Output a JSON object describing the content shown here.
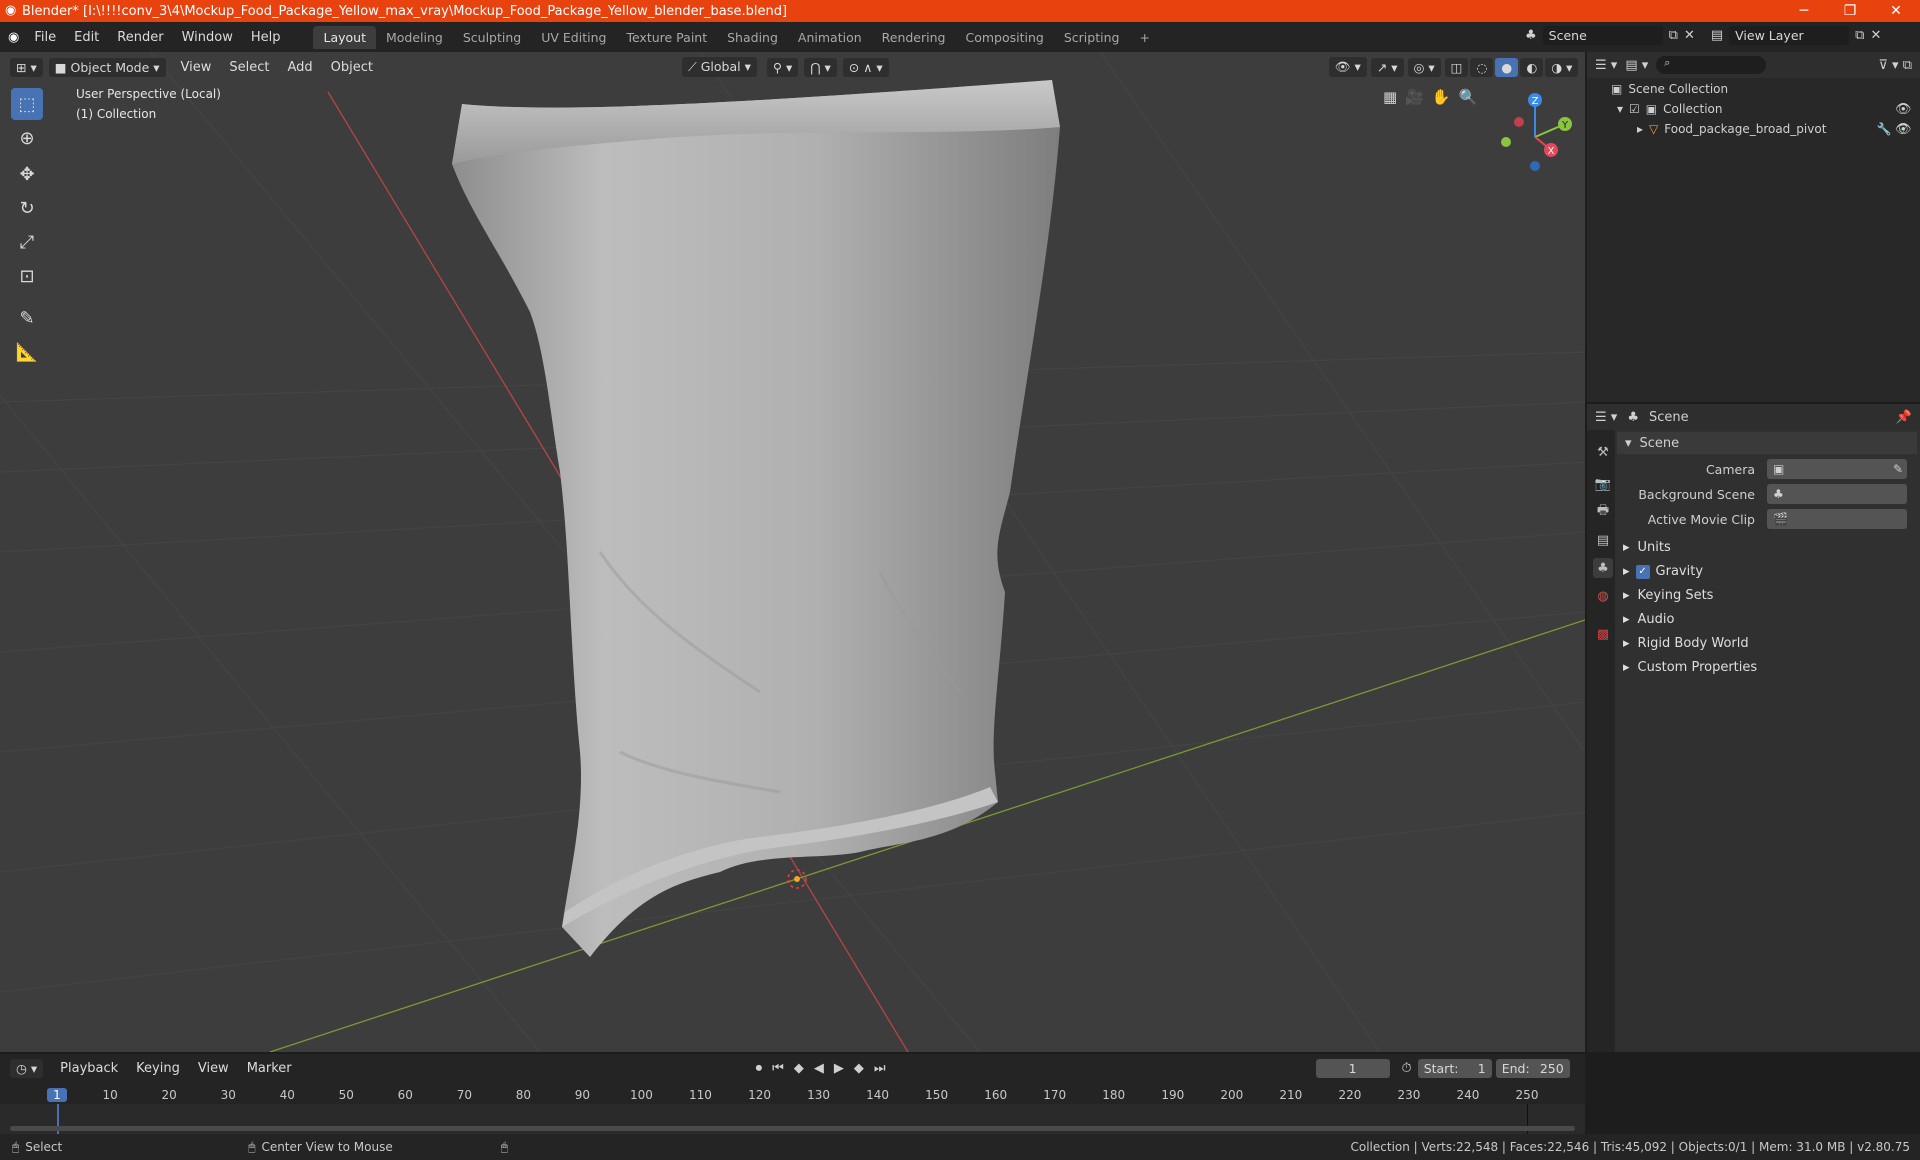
{
  "window": {
    "title": "Blender* [I:\\!!!!conv_3\\4\\Mockup_Food_Package_Yellow_max_vray\\Mockup_Food_Package_Yellow_blender_base.blend]"
  },
  "menus": [
    "File",
    "Edit",
    "Render",
    "Window",
    "Help"
  ],
  "workspaces": [
    "Layout",
    "Modeling",
    "Sculpting",
    "UV Editing",
    "Texture Paint",
    "Shading",
    "Animation",
    "Rendering",
    "Compositing",
    "Scripting"
  ],
  "active_workspace": "Layout",
  "top_right": {
    "scene": "Scene",
    "view_layer": "View Layer"
  },
  "viewport": {
    "mode": "Object Mode",
    "header_menus": [
      "View",
      "Select",
      "Add",
      "Object"
    ],
    "orientation": "Global",
    "overlay_text_1": "User Perspective (Local)",
    "overlay_text_2": "(1) Collection",
    "gizmo_axes": {
      "z": "Z",
      "y": "Y",
      "x": "X"
    }
  },
  "outliner": {
    "root": "Scene Collection",
    "collection": "Collection",
    "object": "Food_package_broad_pivot"
  },
  "properties": {
    "header": "Scene",
    "panel": "Scene",
    "fields": [
      {
        "label": "Camera",
        "value": ""
      },
      {
        "label": "Background Scene",
        "value": ""
      },
      {
        "label": "Active Movie Clip",
        "value": ""
      }
    ],
    "sections": [
      "Units",
      "Gravity",
      "Keying Sets",
      "Audio",
      "Rigid Body World",
      "Custom Properties"
    ]
  },
  "timeline": {
    "menus": [
      "Playback",
      "Keying",
      "View",
      "Marker"
    ],
    "current_frame": "1",
    "start_label": "Start:",
    "start": "1",
    "end_label": "End:",
    "end": "250",
    "ticks": [
      "1",
      "10",
      "20",
      "30",
      "40",
      "50",
      "60",
      "70",
      "80",
      "90",
      "100",
      "110",
      "120",
      "130",
      "140",
      "150",
      "160",
      "170",
      "180",
      "190",
      "200",
      "210",
      "220",
      "230",
      "240",
      "250"
    ]
  },
  "status": {
    "left": "Select",
    "mid": "Center View to Mouse",
    "right": "Collection | Verts:22,548 | Faces:22,546 | Tris:45,092 | Objects:0/1 | Mem: 31.0 MB | v2.80.75"
  },
  "colors": {
    "accent": "#4772b3",
    "title_bar": "#e8430e",
    "x_axis": "#e2495a",
    "y_axis": "#8bc53f",
    "z_axis": "#3b8ae8"
  }
}
